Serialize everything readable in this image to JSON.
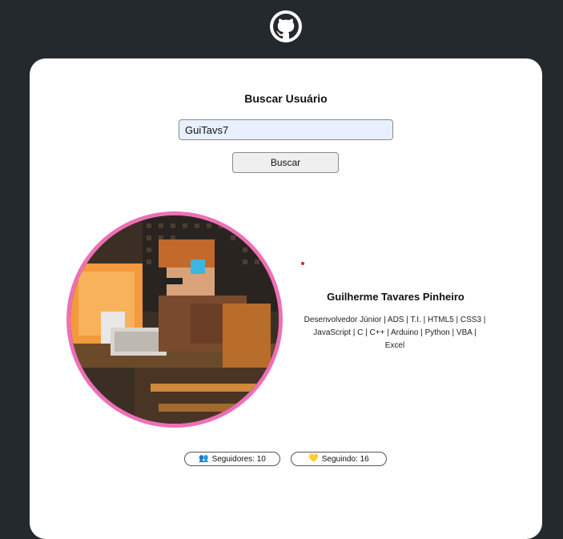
{
  "header": {
    "logo_icon": "github-icon"
  },
  "search": {
    "title": "Buscar Usuário",
    "value": "GuiTavs7",
    "button_label": "Buscar"
  },
  "profile": {
    "avatar_icon": "avatar-pixel-art",
    "name": "Guilherme Tavares Pinheiro",
    "bio": "Desenvolvedor Júnior | ADS | T.I. | HTML5 | CSS3 | JavaScript | C | C++ | Arduino | Python | VBA | Excel",
    "avatar_border_color": "#ee6fb7"
  },
  "stats": {
    "followers_icon": "people-icon",
    "followers_label": "Seguidores: 10",
    "following_icon": "heart-icon",
    "following_label": "Seguindo: 16"
  },
  "colors": {
    "background": "#24292e",
    "card": "#ffffff",
    "accent": "#ee6fb7"
  }
}
